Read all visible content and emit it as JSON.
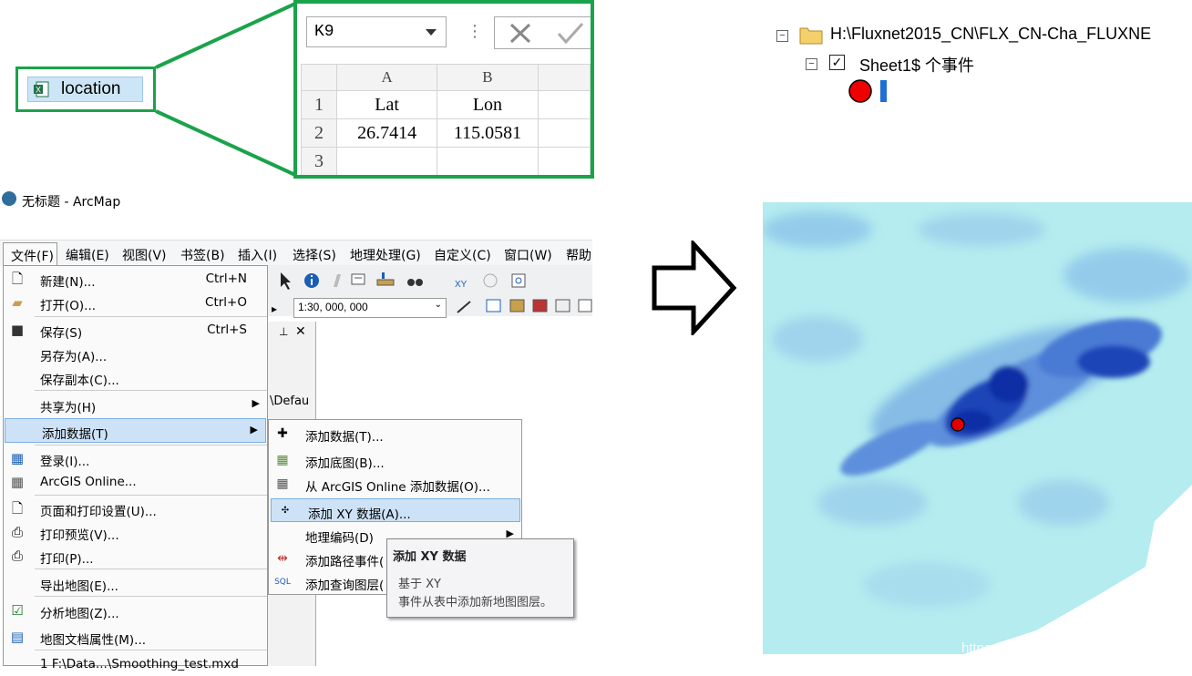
{
  "file": {
    "name": "location"
  },
  "excel": {
    "namebox": "K9",
    "columns": [
      "A",
      "B"
    ],
    "rows": [
      {
        "num": "1",
        "a": "Lat",
        "b": "Lon"
      },
      {
        "num": "2",
        "a": "26.7414",
        "b": "115.0581"
      },
      {
        "num": "3",
        "a": "",
        "b": ""
      }
    ]
  },
  "arcmap": {
    "title": "无标题 - ArcMap",
    "menu": [
      "文件(F)",
      "编辑(E)",
      "视图(V)",
      "书签(B)",
      "插入(I)",
      "选择(S)",
      "地理处理(G)",
      "自定义(C)",
      "窗口(W)",
      "帮助"
    ],
    "scale": "1:30, 000, 000",
    "partial_path": "\\Defau"
  },
  "file_menu": {
    "items": [
      {
        "label": "新建(N)...",
        "shortcut": "Ctrl+N",
        "icon": "new-document-icon"
      },
      {
        "label": "打开(O)...",
        "shortcut": "Ctrl+O",
        "icon": "open-folder-icon"
      },
      {
        "label": "保存(S)",
        "shortcut": "Ctrl+S",
        "icon": "save-disk-icon"
      },
      {
        "label": "另存为(A)...",
        "shortcut": "",
        "icon": ""
      },
      {
        "label": "保存副本(C)...",
        "shortcut": "",
        "icon": ""
      },
      {
        "label": "共享为(H)",
        "shortcut": "",
        "icon": ""
      },
      {
        "label": "添加数据(T)",
        "shortcut": "",
        "icon": ""
      },
      {
        "label": "登录(I)...",
        "shortcut": "",
        "icon": "signin-icon"
      },
      {
        "label": "ArcGIS Online...",
        "shortcut": "",
        "icon": "grid-icon"
      },
      {
        "label": "页面和打印设置(U)...",
        "shortcut": "",
        "icon": "page-setup-icon"
      },
      {
        "label": "打印预览(V)...",
        "shortcut": "",
        "icon": "print-preview-icon"
      },
      {
        "label": "打印(P)...",
        "shortcut": "",
        "icon": "printer-icon"
      },
      {
        "label": "导出地图(E)...",
        "shortcut": "",
        "icon": ""
      },
      {
        "label": "分析地图(Z)...",
        "shortcut": "",
        "icon": "analyze-icon"
      },
      {
        "label": "地图文档属性(M)...",
        "shortcut": "",
        "icon": "properties-icon"
      },
      {
        "label": "1 F:\\Data...\\Smoothing_test.mxd",
        "shortcut": "",
        "icon": ""
      }
    ]
  },
  "sub_menu": {
    "items": [
      {
        "label": "添加数据(T)..."
      },
      {
        "label": "添加底图(B)..."
      },
      {
        "label": "从 ArcGIS Online 添加数据(O)..."
      },
      {
        "label": "添加 XY 数据(A)..."
      },
      {
        "label": "地理编码(D)"
      },
      {
        "label": "添加路径事件("
      },
      {
        "label": "添加查询图层("
      }
    ]
  },
  "tooltip": {
    "title": "添加 XY 数据",
    "line1": "基于 XY",
    "line2": "事件从表中添加新地图图层。"
  },
  "layers": {
    "path": "H:\\Fluxnet2015_CN\\FLX_CN-Cha_FLUXNE",
    "sheet": "Sheet1$ 个事件"
  },
  "watermark": "https://blog.csdn.net/qq_38882446",
  "colors": {
    "callout": "#1aa34a",
    "highlight": "#cde2f6",
    "point": "#e00000",
    "map_light": "#b4ecef",
    "map_dark": "#0b2fa5"
  }
}
